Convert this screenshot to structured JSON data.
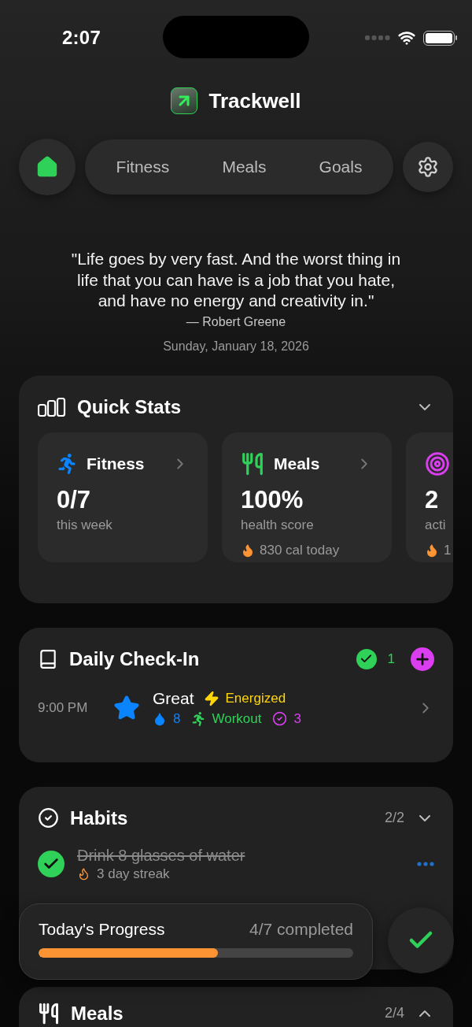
{
  "status_bar": {
    "time": "2:07"
  },
  "app": {
    "title": "Trackwell"
  },
  "nav": {
    "home": {
      "selected": true
    },
    "tabs": [
      {
        "label": "Fitness",
        "selected": false
      },
      {
        "label": "Meals",
        "selected": false
      },
      {
        "label": "Goals",
        "selected": false
      }
    ]
  },
  "quote": {
    "text": "\"Life goes by very fast. And the worst thing in life that you can have is a job that you hate, and have no energy and creativity in.\"",
    "author": "— Robert Greene"
  },
  "date": "Sunday, January 18, 2026",
  "quick_stats": {
    "title": "Quick Stats",
    "expanded": true,
    "cards": [
      {
        "kind": "fitness",
        "title": "Fitness",
        "value": "0/7",
        "caption": "this week"
      },
      {
        "kind": "meals",
        "title": "Meals",
        "value": "100%",
        "caption": "health score",
        "note": "830 cal today"
      },
      {
        "kind": "goals",
        "value": "2",
        "caption": "acti",
        "note": "1"
      }
    ]
  },
  "check_in": {
    "title": "Daily Check-In",
    "count": "1",
    "entries": [
      {
        "time": "9:00 PM",
        "mood": "Great",
        "energy": "Energized",
        "water": "8",
        "activity": "Workout",
        "habits": "3"
      }
    ]
  },
  "habits": {
    "title": "Habits",
    "count": "2/2",
    "expanded": true,
    "items": [
      {
        "name": "Drink 8 glasses of water",
        "checked": true,
        "streak": "3 day streak"
      }
    ]
  },
  "progress": {
    "title": "Today's Progress",
    "summary": "4/7 completed",
    "level": 0.571
  },
  "meals": {
    "title": "Meals",
    "count": "2/4",
    "expanded": false
  }
}
